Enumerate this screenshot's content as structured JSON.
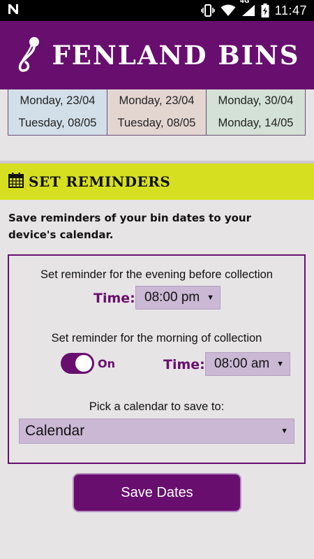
{
  "status_bar": {
    "carrier_icon": "n-notification-icon",
    "network": "4G",
    "time": "11:47"
  },
  "header": {
    "title": "FENLAND BINS",
    "logo_icon": "safety-pin-icon"
  },
  "dates": [
    {
      "first": "Monday, 23/04",
      "second": "Tuesday, 08/05",
      "color": "#d2dfe8"
    },
    {
      "first": "Monday, 23/04",
      "second": "Tuesday, 08/05",
      "color": "#e3d6d1"
    },
    {
      "first": "Monday, 30/04",
      "second": "Monday, 14/05",
      "color": "#d3e1d6"
    }
  ],
  "reminders": {
    "section_title": "SET REMINDERS",
    "section_icon": "calendar-icon",
    "intro": "Save reminders of your bin dates to your device's calendar.",
    "evening_label": "Set reminder for the evening before collection",
    "time_label": "Time:",
    "evening_time": "08:00 pm",
    "morning_label": "Set reminder for the morning of collection",
    "morning_toggle": "On",
    "morning_time": "08:00 am",
    "calendar_label": "Pick a calendar to save to:",
    "calendar_value": "Calendar"
  },
  "actions": {
    "save_label": "Save Dates"
  },
  "colors": {
    "brand_purple": "#680e6e",
    "accent_yellow": "#d6e020",
    "select_bg": "#cbb8d5",
    "background": "#e6e4e5"
  }
}
